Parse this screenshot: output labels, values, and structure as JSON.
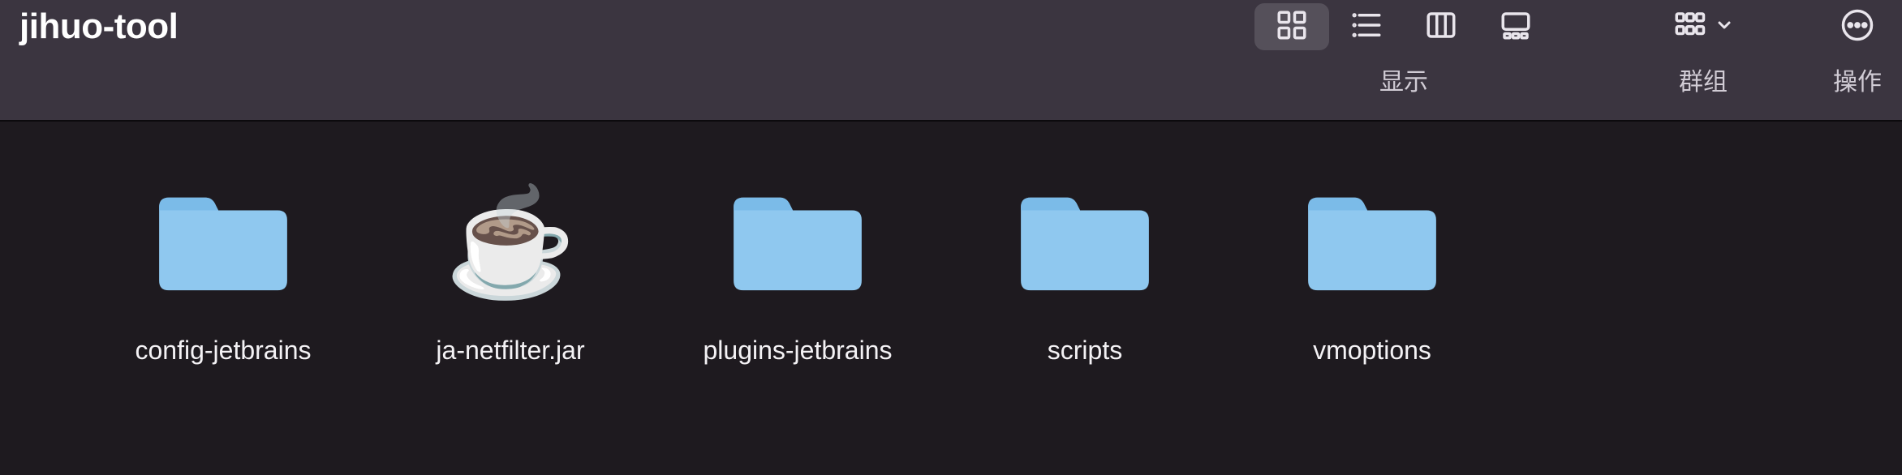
{
  "window": {
    "title": "jihuo-tool"
  },
  "toolbar": {
    "view_label": "显示",
    "group_label": "群组",
    "action_label": "操作"
  },
  "items": [
    {
      "name": "config-jetbrains",
      "type": "folder"
    },
    {
      "name": "ja-netfilter.jar",
      "type": "jar"
    },
    {
      "name": "plugins-jetbrains",
      "type": "folder"
    },
    {
      "name": "scripts",
      "type": "folder"
    },
    {
      "name": "vmoptions",
      "type": "folder"
    }
  ],
  "colors": {
    "folder_fill": "#8fc8ef",
    "folder_tab": "#7bbbe8"
  }
}
